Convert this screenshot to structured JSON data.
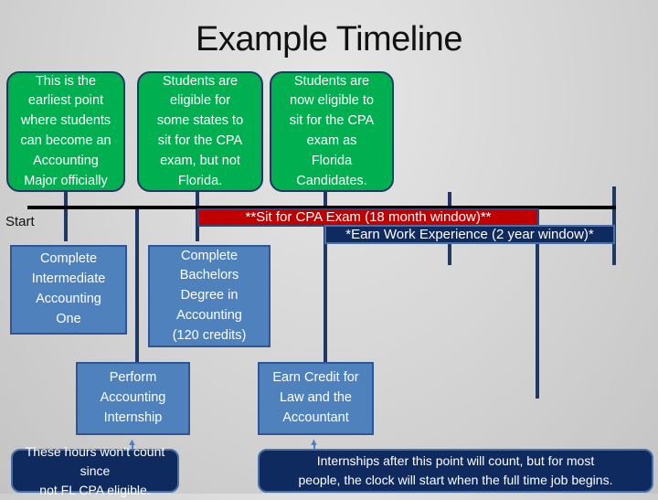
{
  "title": "Example Timeline",
  "timeline": {
    "start_label": "Start",
    "bars": {
      "cpa_exam": "**Sit for CPA Exam (18 month window)**",
      "work_experience": "*Earn Work Experience (2 year window)*"
    }
  },
  "milestones_top": [
    {
      "text": "This is the\nearliest point\nwhere students\ncan become an\nAccounting\nMajor officially"
    },
    {
      "text": "Students are\neligible for\nsome states to\nsit for the CPA\nexam, but not\nFlorida."
    },
    {
      "text": "Students are\nnow eligible to\nsit for the CPA\nexam as\nFlorida\nCandidates."
    }
  ],
  "milestones_bottom": [
    {
      "text": "Complete\nIntermediate\nAccounting\nOne"
    },
    {
      "text": "Complete\nBachelors\nDegree in\nAccounting\n(120 credits)"
    },
    {
      "text": "Perform\nAccounting\nInternship"
    },
    {
      "text": "Earn Credit for\nLaw and the\nAccountant"
    }
  ],
  "notes": [
    {
      "text": "These hours won’t count since\nnot FL CPA eligible."
    },
    {
      "text": "Internships after this point will count, but for most\npeople, the clock will start when the full time job begins."
    }
  ],
  "colors": {
    "green": "#00b050",
    "blue": "#4f81bd",
    "navy": "#0f2a5e",
    "red": "#c00000",
    "line": "#1f3864"
  }
}
